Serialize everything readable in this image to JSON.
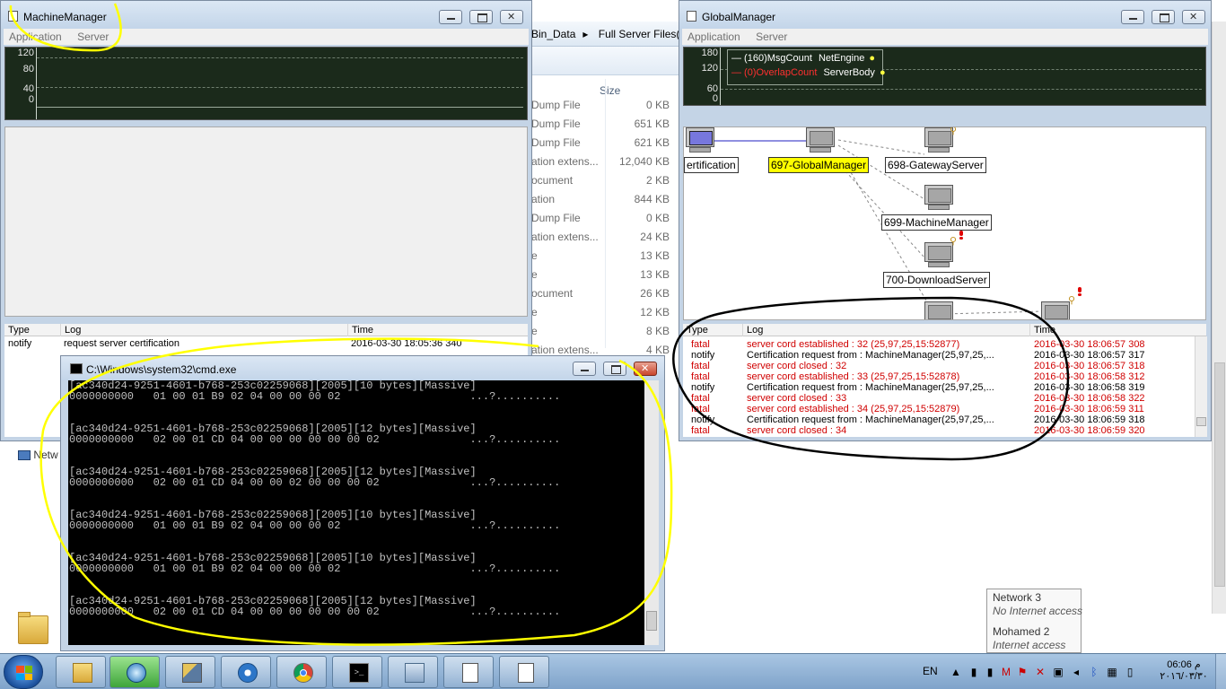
{
  "explorer": {
    "breadcrumb": [
      "Bin_Data",
      "Full Server Files(By"
    ],
    "size_header": "Size",
    "rows": [
      {
        "type": "Dump File",
        "size": "0 KB"
      },
      {
        "type": "Dump File",
        "size": "651 KB"
      },
      {
        "type": "Dump File",
        "size": "621 KB"
      },
      {
        "type": "ation extens...",
        "size": "12,040 KB"
      },
      {
        "type": "ocument",
        "size": "2 KB"
      },
      {
        "type": "ation",
        "size": "844 KB"
      },
      {
        "type": "Dump File",
        "size": "0 KB"
      },
      {
        "type": "ation extens...",
        "size": "24 KB"
      },
      {
        "type": "e",
        "size": "13 KB"
      },
      {
        "type": "e",
        "size": "13 KB"
      },
      {
        "type": "ocument",
        "size": "26 KB"
      },
      {
        "type": "e",
        "size": "12 KB"
      },
      {
        "type": "e",
        "size": "8 KB"
      },
      {
        "type": "ation extens...",
        "size": "4 KB"
      }
    ],
    "net_label": "Netw"
  },
  "machine_manager": {
    "title": "MachineManager",
    "menu": [
      "Application",
      "Server"
    ],
    "graph_ticks": [
      "120",
      "80",
      "40",
      "0"
    ],
    "log_columns": [
      "Type",
      "Log",
      "Time"
    ],
    "log_row": {
      "type": "notify",
      "log": "request server certification",
      "time": "2016-03-30 18:05:36 340"
    }
  },
  "global_manager": {
    "title": "GlobalManager",
    "menu": [
      "Application",
      "Server"
    ],
    "graph_ticks": [
      "180",
      "120",
      "60",
      "0"
    ],
    "legend": [
      {
        "mark": "— (160)MsgCount",
        "name": "NetEngine",
        "color": "#ffffff"
      },
      {
        "mark": "— (0)OverlapCount",
        "name": "ServerBody",
        "color": "#ff3030"
      }
    ],
    "nodes": {
      "certification": "ertification",
      "global": "697-GlobalManager",
      "gateway": "698-GatewayServer",
      "machine": "699-MachineManager",
      "download": "700-DownloadServer"
    },
    "log_columns": [
      "Type",
      "Log",
      "Time"
    ],
    "log_rows": [
      {
        "type": "fatal",
        "log": "server cord established : 32 (25,97,25,15:52877)",
        "time": "2016-03-30 18:06:57 308",
        "level": "red"
      },
      {
        "type": "notify",
        "log": "Certification request from : MachineManager(25,97,25,...",
        "time": "2016-03-30 18:06:57 317",
        "level": "blk"
      },
      {
        "type": "fatal",
        "log": "server cord closed : 32",
        "time": "2016-03-30 18:06:57 318",
        "level": "red"
      },
      {
        "type": "fatal",
        "log": "server cord established : 33 (25,97,25,15:52878)",
        "time": "2016-03-30 18:06:58 312",
        "level": "red"
      },
      {
        "type": "notify",
        "log": "Certification request from : MachineManager(25,97,25,...",
        "time": "2016-03-30 18:06:58 319",
        "level": "blk"
      },
      {
        "type": "fatal",
        "log": "server cord closed : 33",
        "time": "2016-03-30 18:06:58 322",
        "level": "red"
      },
      {
        "type": "fatal",
        "log": "server cord established : 34 (25,97,25,15:52879)",
        "time": "2016-03-30 18:06:59 311",
        "level": "red"
      },
      {
        "type": "notify",
        "log": "Certification request from : MachineManager(25,97,25,...",
        "time": "2016-03-30 18:06:59 318",
        "level": "blk"
      },
      {
        "type": "fatal",
        "log": "server cord closed : 34",
        "time": "2016-03-30 18:06:59 320",
        "level": "red"
      }
    ]
  },
  "cmd": {
    "title": "C:\\Windows\\system32\\cmd.exe",
    "lines": [
      "[ac340d24-9251-4601-b768-253c02259068][2005][10 bytes][Massive]",
      "0000000000   01 00 01 B9 02 04 00 00 00 02                    ...?..........",
      "",
      "",
      "[ac340d24-9251-4601-b768-253c02259068][2005][12 bytes][Massive]",
      "0000000000   02 00 01 CD 04 00 00 00 00 00 00 02              ...?..........",
      "",
      "",
      "[ac340d24-9251-4601-b768-253c02259068][2005][12 bytes][Massive]",
      "0000000000   02 00 01 CD 04 00 00 02 00 00 00 02              ...?..........",
      "",
      "",
      "[ac340d24-9251-4601-b768-253c02259068][2005][10 bytes][Massive]",
      "0000000000   01 00 01 B9 02 04 00 00 00 02                    ...?..........",
      "",
      "",
      "[ac340d24-9251-4601-b768-253c02259068][2005][10 bytes][Massive]",
      "0000000000   01 00 01 B9 02 04 00 00 00 02                    ...?..........",
      "",
      "",
      "[ac340d24-9251-4601-b768-253c02259068][2005][12 bytes][Massive]",
      "0000000000   02 00 01 CD 04 00 00 00 00 00 00 02              ...?.........."
    ]
  },
  "network_popup": {
    "net1": "Network  3",
    "net1_status": "No Internet access",
    "net2": "Mohamed  2",
    "net2_status": "Internet access"
  },
  "taskbar": {
    "apps": [
      "explorer-icon",
      "media-icon",
      "tools-icon",
      "app-icon",
      "chrome-icon",
      "cmd-icon",
      "manager-icon",
      "doc-icon",
      "doc-icon"
    ],
    "lang": "EN",
    "time": "06:06 م",
    "date": "٢٠١٦/٠٣/٣٠"
  },
  "colors": {
    "annotation_yellow": "#ffff00",
    "annotation_black": "#000000",
    "selected_node": "#ffff00",
    "fatal": "#d00000"
  }
}
